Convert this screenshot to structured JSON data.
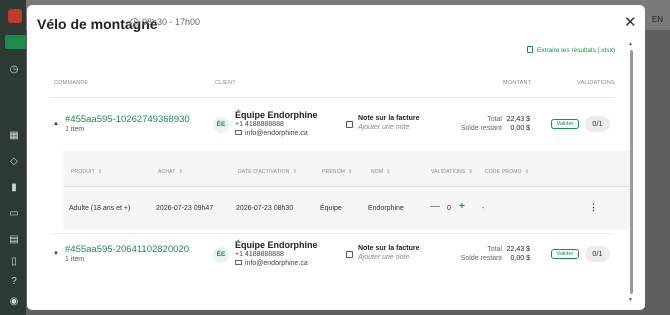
{
  "background": {
    "lang": "EN"
  },
  "modal": {
    "title": "Vélo de montagne",
    "time": "08h30 - 17h00",
    "export_label": "Extraire les résultats (.xlsx)",
    "columns": {
      "commande": "COMMANDE",
      "client": "CLIENT",
      "montant": "MONTANT",
      "validations": "VALIDATIONS"
    }
  },
  "orders": [
    {
      "id": "#455aa595-10262749368930",
      "items": "1 item",
      "client_initials": "ÉE",
      "client_name": "Équipe Endorphine",
      "phone": "+1 4188888888",
      "email": "info@endorphine.ca",
      "note_title": "Note sur la facture",
      "note_placeholder": "Ajouter une note",
      "total_label": "Total",
      "total_value": "22,43 $",
      "balance_label": "Solde restant",
      "balance_value": "0,00 $",
      "validate_label": "Valider",
      "validations": "0/1"
    },
    {
      "id": "#455aa595-20641102820020",
      "items": "1 item",
      "client_initials": "ÉE",
      "client_name": "Équipe Endorphine",
      "phone": "+1 4188888888",
      "email": "info@endorphine.ca",
      "note_title": "Note sur la facture",
      "note_placeholder": "Ajouter une note",
      "total_label": "Total",
      "total_value": "22,43 $",
      "balance_label": "Solde restant",
      "balance_value": "0,00 $",
      "validate_label": "Valider",
      "validations": "0/1"
    }
  ],
  "detail": {
    "headers": [
      "PRODUIT",
      "ACHAT",
      "DATE D'ACTIVATION",
      "PRÉNOM",
      "NOM",
      "VALIDATIONS",
      "CODE PROMO"
    ],
    "row": {
      "produit": "Adulte (18 ans et +)",
      "achat": "2026-07-23 09h47",
      "activation": "2026-07-23 08h30",
      "prenom": "Équipe",
      "nom": "Endorphine",
      "validations_minus": "—",
      "validations_count": "0",
      "validations_plus": "+",
      "code_promo": "-"
    }
  },
  "colors": {
    "accent": "#1f8a4c",
    "overlay": "#6b6b6b"
  }
}
